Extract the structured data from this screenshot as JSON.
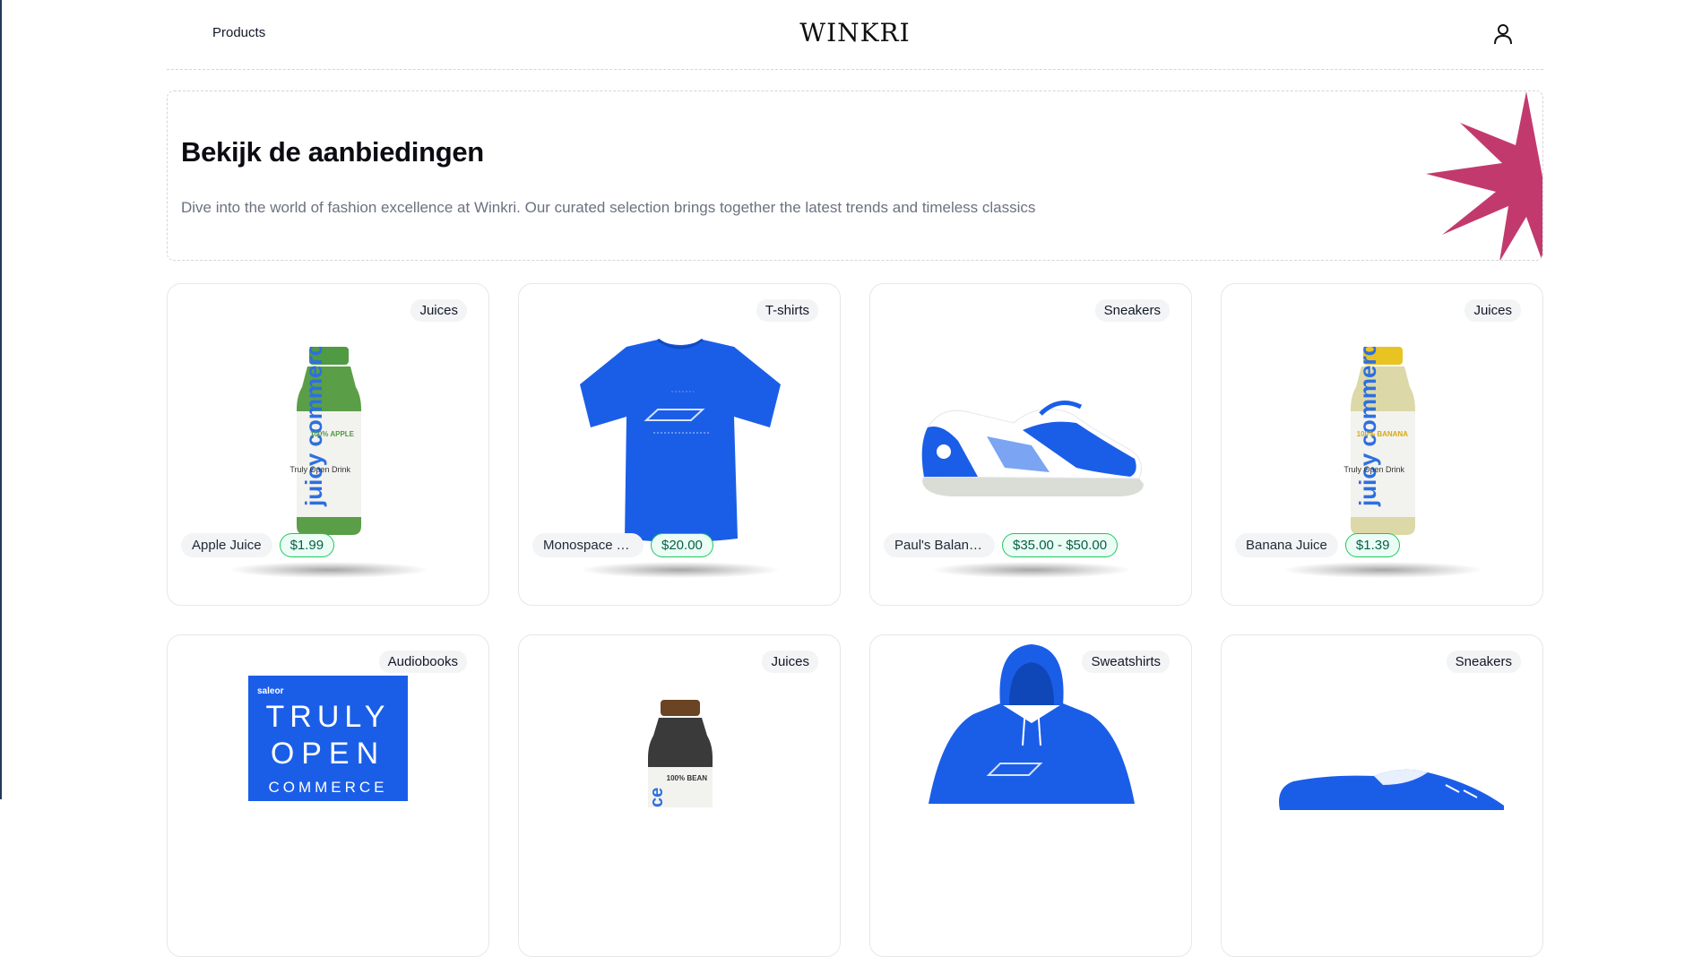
{
  "header": {
    "nav_products": "Products",
    "logo": "WINKRI"
  },
  "hero": {
    "title": "Bekijk de aanbiedingen",
    "description": "Dive into the world of fashion excellence at Winkri. Our curated selection brings together the latest trends and timeless classics"
  },
  "products": [
    {
      "category": "Juices",
      "name": "Apple Juice",
      "price": "$1.99",
      "image_text": "juicy commerce",
      "image_text_2": "100% APPLE",
      "image_text_3": "Truly Open Drink"
    },
    {
      "category": "T-shirts",
      "name": "Monospace T...",
      "price": "$20.00"
    },
    {
      "category": "Sneakers",
      "name": "Paul's Balanc...",
      "price": "$35.00 - $50.00"
    },
    {
      "category": "Juices",
      "name": "Banana Juice",
      "price": "$1.39",
      "image_text": "juicy commerce",
      "image_text_2": "100% BANANA",
      "image_text_3": "Truly Open Drink"
    },
    {
      "category": "Audiobooks",
      "image_brand": "saleor",
      "image_lines": [
        "TRULY",
        "OPEN",
        "COMMERCE"
      ]
    },
    {
      "category": "Juices",
      "image_text_2": "100% BEAN"
    },
    {
      "category": "Sweatshirts"
    },
    {
      "category": "Sneakers"
    }
  ],
  "colors": {
    "accent_star": "#c23a6d",
    "product_blue": "#1a5ee8",
    "price_border": "#22c55e"
  },
  "icons": {
    "user": "user-icon"
  }
}
